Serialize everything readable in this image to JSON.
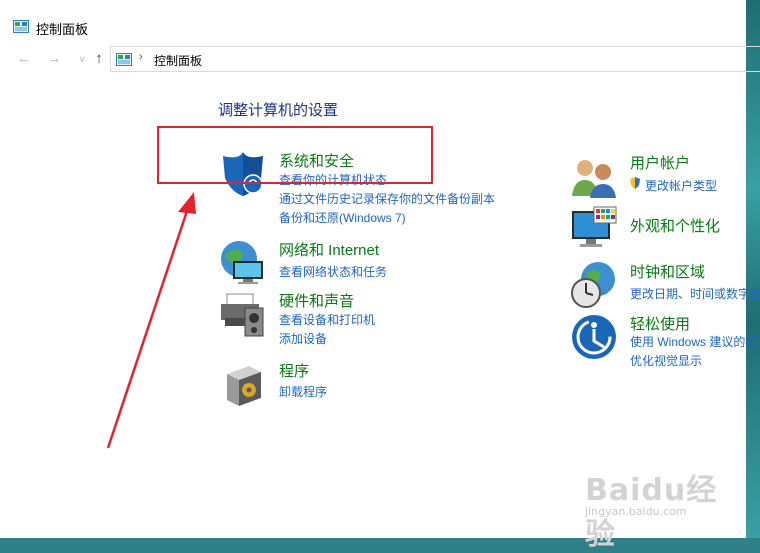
{
  "window": {
    "title": "控制面板"
  },
  "nav": {
    "back_icon": "arrow-left-icon",
    "forward_icon": "arrow-right-icon",
    "recent_icon": "chevron-down-icon",
    "up_icon": "arrow-up-icon",
    "separator": "›",
    "breadcrumb": "控制面板"
  },
  "main": {
    "heading": "调整计算机的设置",
    "categories": [
      {
        "title": "系统和安全",
        "icon": "shield-icon",
        "links": [
          "查看你的计算机状态",
          "通过文件历史记录保存你的文件备份副本",
          "备份和还原(Windows 7)"
        ]
      },
      {
        "title": "网络和 Internet",
        "icon": "network-globe-icon",
        "links": [
          "查看网络状态和任务"
        ]
      },
      {
        "title": "硬件和声音",
        "icon": "printer-speaker-icon",
        "links": [
          "查看设备和打印机",
          "添加设备"
        ]
      },
      {
        "title": "程序",
        "icon": "program-box-icon",
        "links": [
          "卸载程序"
        ]
      },
      {
        "title": "用户帐户",
        "icon": "users-icon",
        "links": [
          "更改帐户类型"
        ]
      },
      {
        "title": "外观和个性化",
        "icon": "monitor-palette-icon",
        "links": []
      },
      {
        "title": "时钟和区域",
        "icon": "clock-globe-icon",
        "links": [
          "更改日期、时间或数字格"
        ]
      },
      {
        "title": "轻松使用",
        "icon": "ease-of-access-icon",
        "links": [
          "使用 Windows 建议的设",
          "优化视觉显示"
        ]
      }
    ]
  },
  "watermark": {
    "main": "Baidu经验",
    "sub": "jingyan.baidu.com"
  },
  "colors": {
    "heading": "#1e3287",
    "category": "#0a7a12",
    "link": "#1f66c1",
    "annotation": "#e2232d"
  }
}
